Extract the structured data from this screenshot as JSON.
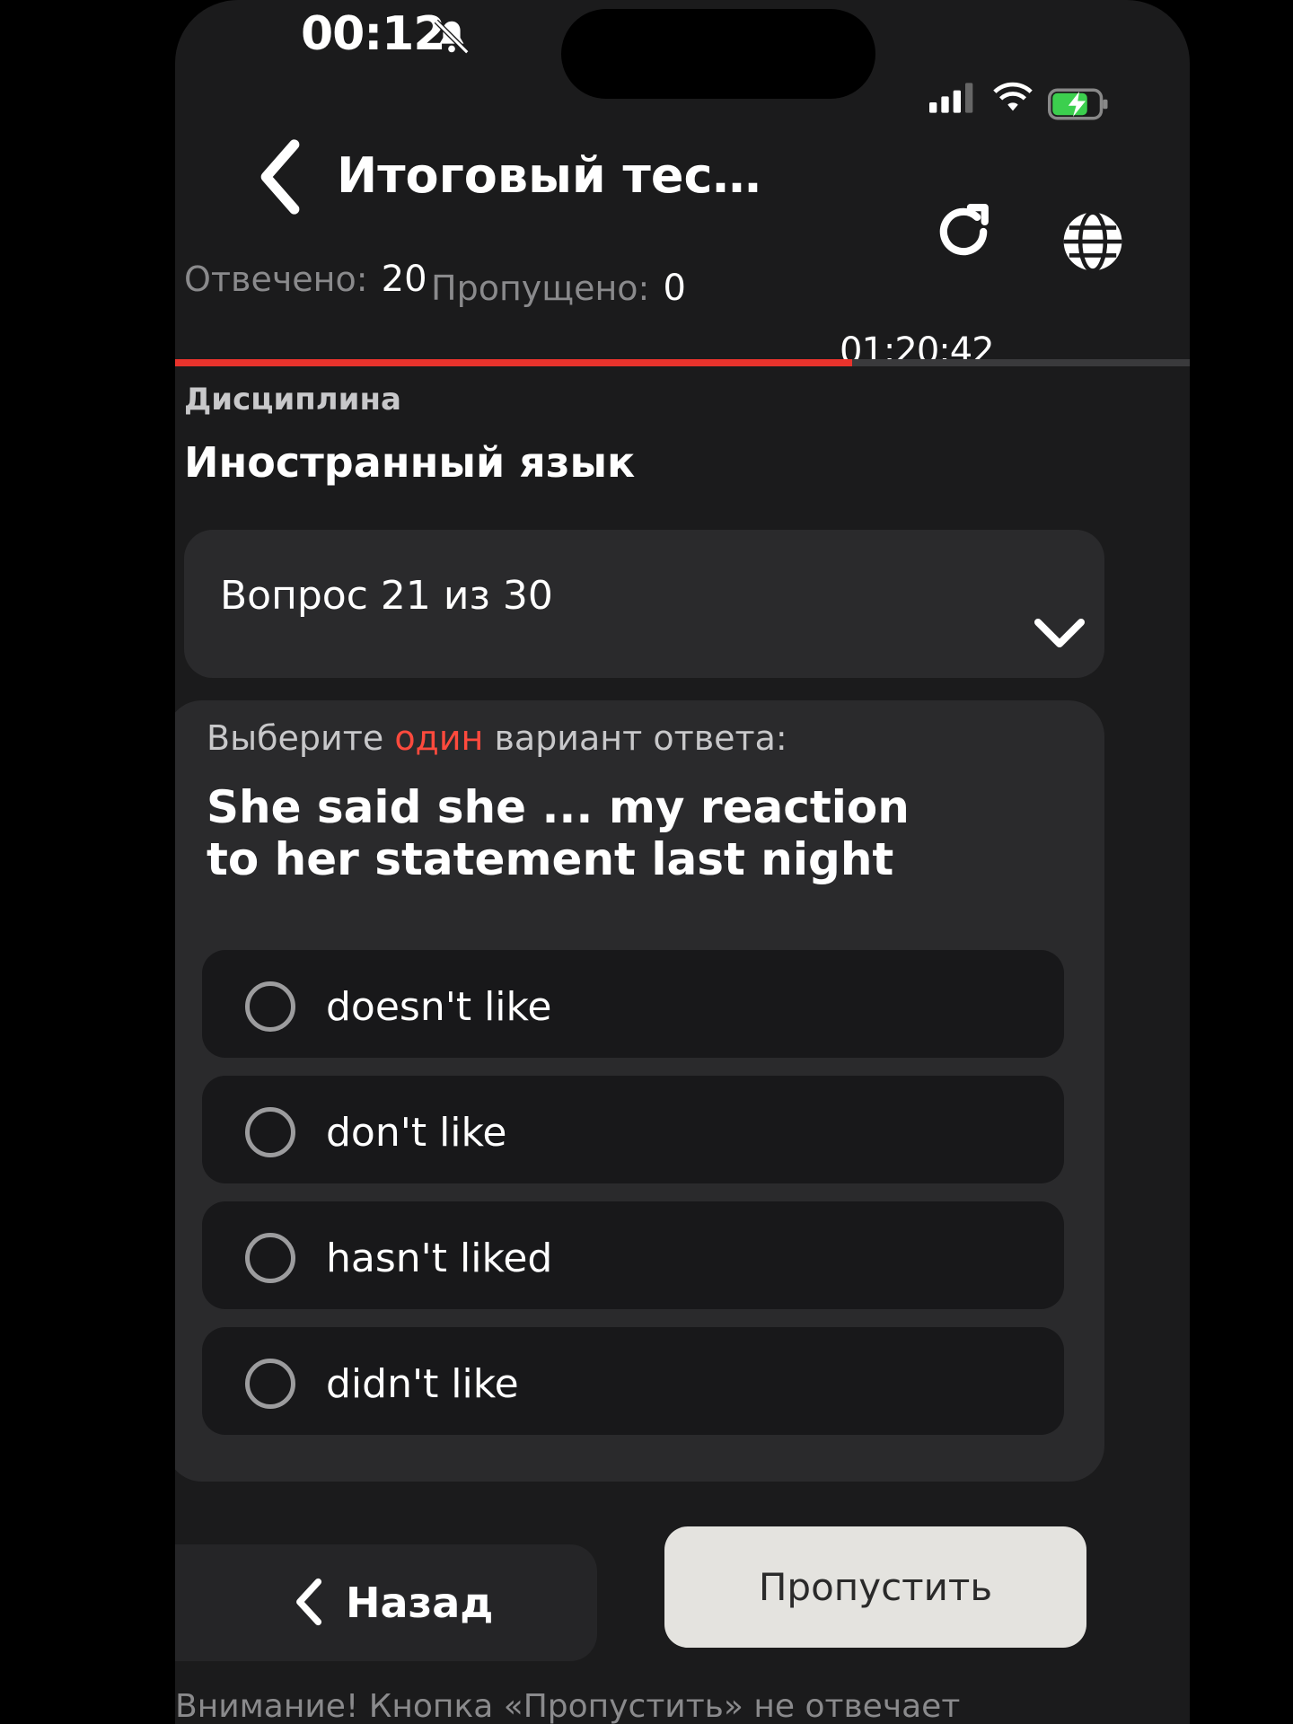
{
  "status_bar": {
    "time": "00:12",
    "icons": [
      "bell-off-icon",
      "signal-icon",
      "wifi-icon",
      "battery-charging-icon"
    ]
  },
  "header": {
    "title": "Итоговый тест (пер...",
    "back_icon": "chevron-left-icon",
    "actions": [
      "reload-icon",
      "globe-icon"
    ]
  },
  "stats": {
    "answered_label": "Отвечено:",
    "answered_value": "20",
    "skipped_label": "Пропущено:",
    "skipped_value": "0",
    "timer": "01:20:42",
    "progress_fraction": 0.667
  },
  "discipline": {
    "label": "Дисциплина",
    "value": "Иностранный язык"
  },
  "question_select": {
    "label": "Вопрос 21 из 30"
  },
  "question": {
    "instruction_before": "Выберите",
    "instruction_accent": "один",
    "instruction_after": "вариант ответа:",
    "text": "She said she ... my reaction to her statement last night",
    "options": [
      {
        "label": "doesn't like"
      },
      {
        "label": "don't like"
      },
      {
        "label": "hasn't liked"
      },
      {
        "label": "didn't like"
      }
    ]
  },
  "footer": {
    "back_label": "Назад",
    "skip_label": "Пропустить",
    "warning": "Внимание! Кнопка «Пропустить» не отвечает"
  },
  "colors": {
    "accent": "#e8332c",
    "background": "#1b1b1c",
    "card": "#2a2a2c",
    "option": "#18181a",
    "skip_button": "#e4e3df"
  }
}
